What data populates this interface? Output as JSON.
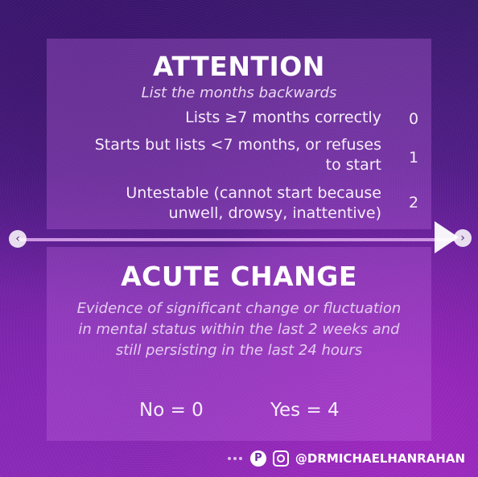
{
  "attention": {
    "title": "ATTENTION",
    "subtitle": "List the months backwards",
    "rows": [
      {
        "text": "Lists ≥7 months correctly",
        "score": "0"
      },
      {
        "text": "Starts but lists <7 months, or refuses to start",
        "score": "1"
      },
      {
        "text": "Untestable (cannot start because unwell, drowsy, inattentive)",
        "score": "2"
      }
    ]
  },
  "acute": {
    "title": "ACUTE CHANGE",
    "description": "Evidence of significant change or fluctuation in mental status within the last 2 weeks and still persisting in the last 24 hours",
    "options": {
      "no": "No = 0",
      "yes": "Yes = 4"
    }
  },
  "nav": {
    "prev_icon": "chevron-left-icon",
    "next_icon": "chevron-right-icon",
    "play_icon": "play-icon"
  },
  "footer": {
    "handle": "@DRMICHAELHANRAHAN",
    "icons": [
      "pinterest-icon",
      "instagram-icon"
    ]
  },
  "colors": {
    "bg_top": "#3a1a6e",
    "bg_bottom": "#8c2bb5",
    "panel": "#ba64dc",
    "divider": "#e1aaf0"
  }
}
